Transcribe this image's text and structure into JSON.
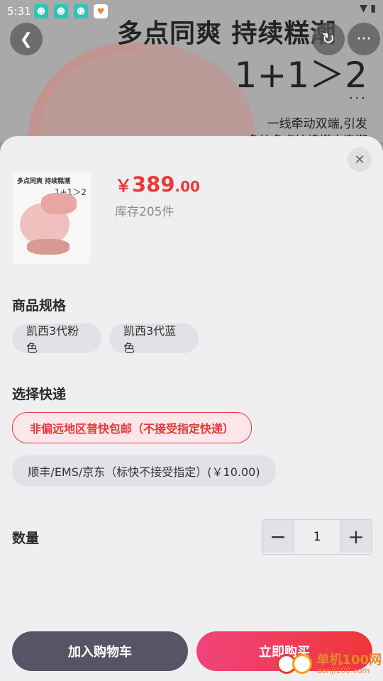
{
  "status_bar": {
    "time": "5:31"
  },
  "hero": {
    "title": "多点同爽 持续糕潮",
    "formula": "1+1＞2",
    "dots": "···",
    "subtitle_1": "一线牵动双端,引发",
    "subtitle_2": "多处多点持续燃爽高潮"
  },
  "header_actions": {
    "back_icon": "chevron-left-icon",
    "share_icon": "share-icon",
    "more_icon": "more-icon"
  },
  "product": {
    "thumb_title": "多点同爽 持续糕潮",
    "thumb_formula": "1+1＞2",
    "price_currency": "￥",
    "price_integer": "389",
    "price_decimal": ".00",
    "stock": "库存205件"
  },
  "spec": {
    "title": "商品规格",
    "options": [
      "凯西3代粉色",
      "凯西3代蓝色"
    ]
  },
  "shipping": {
    "title": "选择快递",
    "options": [
      "非偏远地区普快包邮（不接受指定快递）",
      "顺丰/EMS/京东（标快不接受指定）(￥10.00)"
    ],
    "selected_index": 0
  },
  "quantity": {
    "label": "数量",
    "value": "1",
    "minus": "−",
    "plus": "+"
  },
  "actions": {
    "add_to_cart": "加入购物车",
    "buy_now": "立即购买"
  },
  "watermark": {
    "name": "单机100网",
    "url": "danji100.com"
  },
  "colors": {
    "accent": "#e83a3a",
    "cart_button": "#565566",
    "buy_gradient_start": "#f1437d",
    "buy_gradient_end": "#ef3637"
  }
}
